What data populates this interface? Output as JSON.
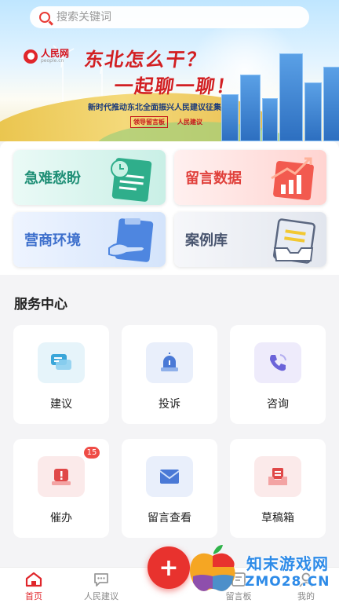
{
  "search": {
    "placeholder": "搜索关键词"
  },
  "banner": {
    "logo_text": "人民网",
    "logo_sub": "people.cn",
    "headline_line1": "东北怎么干？",
    "headline_line2": "一起聊一聊！",
    "subline": "新时代推动东北全面振兴人民建议征集",
    "sponsor1": "领导留言板",
    "sponsor2": "人民建议"
  },
  "quick_cards": [
    {
      "label": "急难愁盼",
      "icon": "clipboard-clock-icon"
    },
    {
      "label": "留言数据",
      "icon": "chart-growth-icon"
    },
    {
      "label": "营商环境",
      "icon": "handshake-doc-icon"
    },
    {
      "label": "案例库",
      "icon": "archive-box-icon"
    }
  ],
  "services": {
    "title": "服务中心",
    "items": [
      {
        "label": "建议",
        "icon": "chat-bubbles-icon",
        "color": "#3aa6d9"
      },
      {
        "label": "投诉",
        "icon": "alarm-light-icon",
        "color": "#4a79d6"
      },
      {
        "label": "咨询",
        "icon": "phone-icon",
        "color": "#6b63d9"
      },
      {
        "label": "催办",
        "icon": "urge-alert-icon",
        "color": "#e04848",
        "badge": "15"
      },
      {
        "label": "留言查看",
        "icon": "envelope-icon",
        "color": "#4a79d6"
      },
      {
        "label": "草稿箱",
        "icon": "draft-tray-icon",
        "color": "#e04848"
      }
    ]
  },
  "bottom_nav": [
    {
      "label": "首页",
      "icon": "home-icon",
      "active": true
    },
    {
      "label": "人民建议",
      "icon": "chat-icon",
      "active": false
    },
    {
      "label": "留言板",
      "icon": "board-icon",
      "active": false
    },
    {
      "label": "我的",
      "icon": "user-icon",
      "active": false
    }
  ],
  "fab": {
    "label": "+"
  },
  "watermark": {
    "line1": "知末游戏网",
    "line2": "ZMO28.CN"
  },
  "colors": {
    "accent": "#e8322e",
    "brand_red": "#d21f22"
  }
}
